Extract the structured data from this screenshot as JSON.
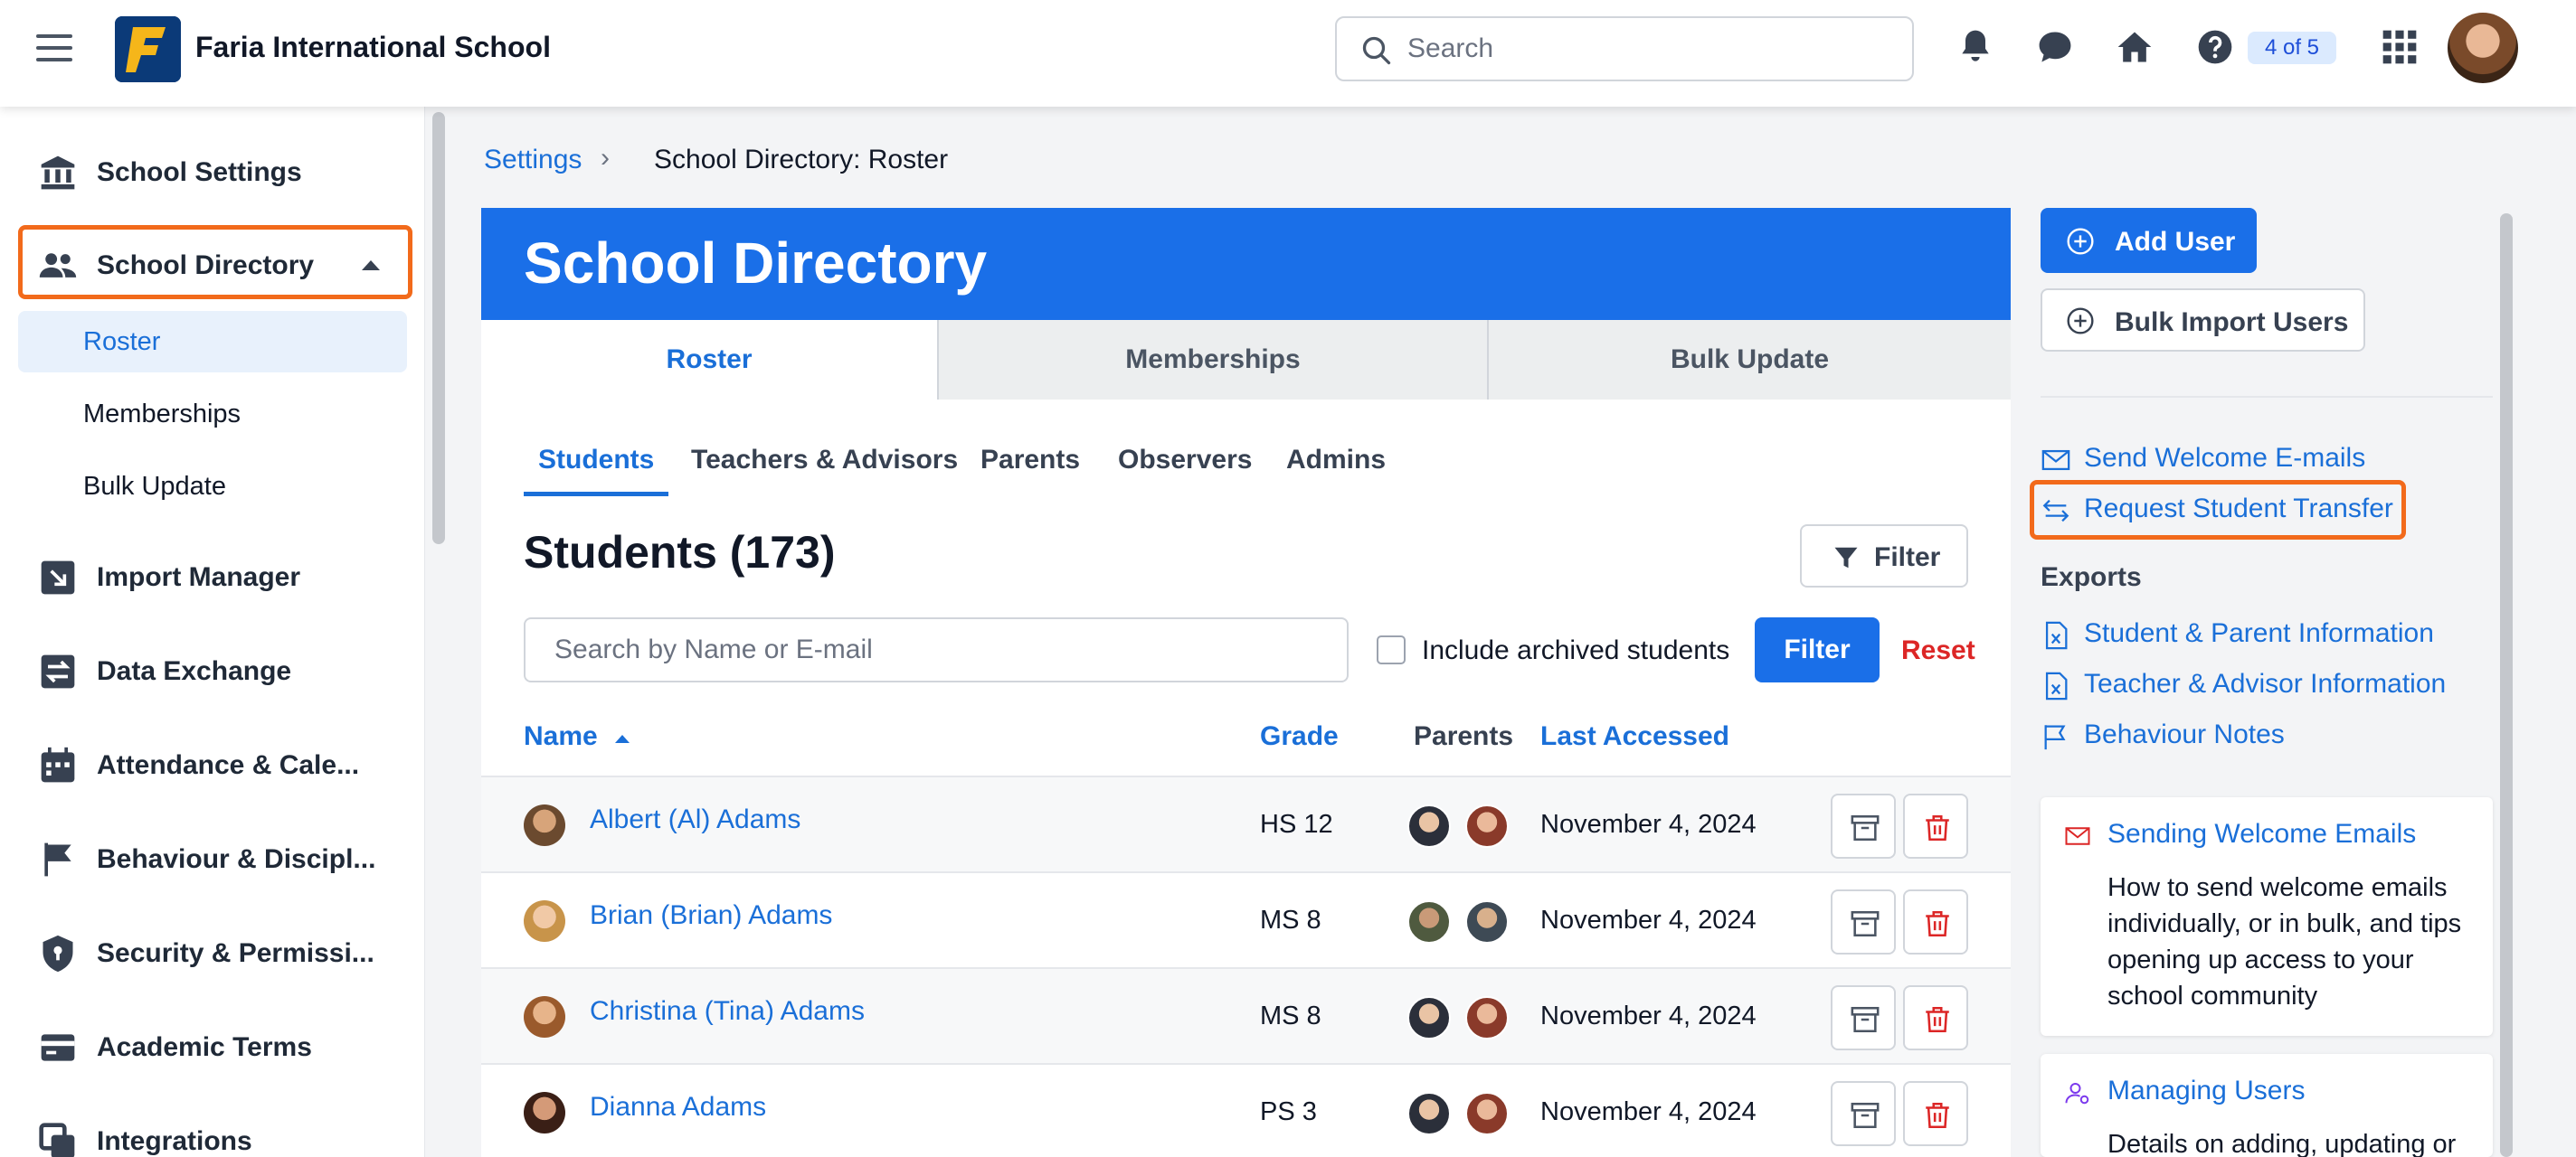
{
  "app": {
    "title": "Faria International School"
  },
  "top": {
    "search_placeholder": "Search",
    "notification_count": "4 of 5"
  },
  "sidebar": {
    "items": [
      {
        "label": "School Settings",
        "icon": "bank-icon"
      },
      {
        "label": "School Directory",
        "icon": "people-icon"
      },
      {
        "label": "Import Manager",
        "icon": "import-icon"
      },
      {
        "label": "Data Exchange",
        "icon": "exchange-icon"
      },
      {
        "label": "Attendance & Cale...",
        "icon": "calendar-icon"
      },
      {
        "label": "Behaviour & Discipl...",
        "icon": "flag-icon"
      },
      {
        "label": "Security & Permissi...",
        "icon": "shield-icon"
      },
      {
        "label": "Academic Terms",
        "icon": "terms-icon"
      },
      {
        "label": "Integrations",
        "icon": "integrations-icon"
      }
    ],
    "subitems": [
      {
        "label": "Roster"
      },
      {
        "label": "Memberships"
      },
      {
        "label": "Bulk Update"
      }
    ]
  },
  "breadcrumb": {
    "parent": "Settings",
    "current": "School Directory: Roster"
  },
  "card": {
    "title": "School Directory",
    "tabs": [
      {
        "label": "Roster"
      },
      {
        "label": "Memberships"
      },
      {
        "label": "Bulk Update"
      }
    ],
    "subtabs": [
      {
        "label": "Students"
      },
      {
        "label": "Teachers & Advisors"
      },
      {
        "label": "Parents"
      },
      {
        "label": "Observers"
      },
      {
        "label": "Admins"
      }
    ],
    "heading": "Students (173)",
    "filter_label": "Filter",
    "search_placeholder": "Search by Name or E-mail",
    "include_archived_label": "Include archived students",
    "filter_button": "Filter",
    "reset_label": "Reset",
    "columns": {
      "name": "Name",
      "grade": "Grade",
      "parents": "Parents",
      "last_accessed": "Last Accessed"
    },
    "rows": [
      {
        "name": "Albert (Al) Adams",
        "grade": "HS 12",
        "last_accessed": "November 4, 2024"
      },
      {
        "name": "Brian (Brian) Adams",
        "grade": "MS 8",
        "last_accessed": "November 4, 2024"
      },
      {
        "name": "Christina (Tina) Adams",
        "grade": "MS 8",
        "last_accessed": "November 4, 2024"
      },
      {
        "name": "Dianna Adams",
        "grade": "PS 3",
        "last_accessed": "November 4, 2024"
      }
    ]
  },
  "right_panel": {
    "add_user": "Add User",
    "bulk_import": "Bulk Import Users",
    "send_welcome": "Send Welcome E-mails",
    "request_transfer": "Request Student Transfer",
    "exports_heading": "Exports",
    "exports": [
      {
        "label": "Student & Parent Information"
      },
      {
        "label": "Teacher & Advisor Information"
      },
      {
        "label": "Behaviour Notes"
      }
    ],
    "help_cards": [
      {
        "title": "Sending Welcome Emails",
        "body": "How to send welcome emails individually, or in bulk, and tips opening up access to your school community"
      },
      {
        "title": "Managing Users",
        "body": "Details on adding, updating or"
      }
    ]
  },
  "colors": {
    "brand": "#1a6fe8",
    "highlight": "#f26a1b",
    "danger": "#dc2626"
  }
}
